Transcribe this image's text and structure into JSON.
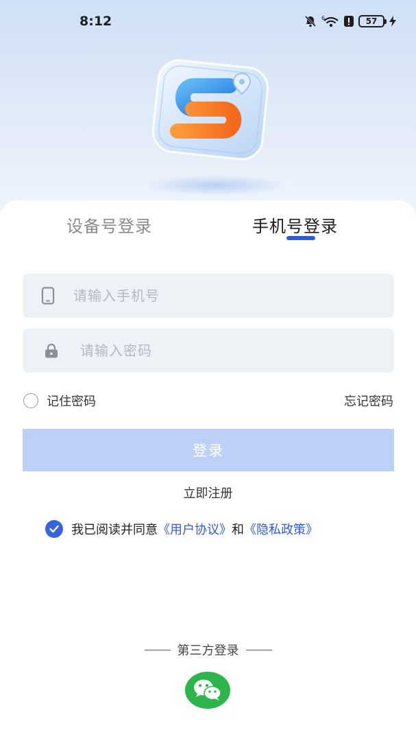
{
  "status_bar": {
    "time": "8:12",
    "battery": "57",
    "icons": [
      "mute-bell-icon",
      "wifi-icon",
      "alert-icon",
      "battery-icon",
      "charging-icon"
    ]
  },
  "tabs": {
    "device_login": "设备号登录",
    "phone_login": "手机号登录",
    "active": "phone_login"
  },
  "form": {
    "phone_placeholder": "请输入手机号",
    "phone_value": "",
    "password_placeholder": "请输入密码",
    "password_value": "",
    "remember_label": "记住密码",
    "remember_checked": false,
    "forgot_label": "忘记密码"
  },
  "actions": {
    "login_label": "登录",
    "register_label": "立即注册"
  },
  "agreement": {
    "checked": true,
    "prefix": "我已阅读并同意",
    "user_agreement": "《用户协议》",
    "conjunction": "和",
    "privacy_policy": "《隐私政策》"
  },
  "third_party": {
    "label": "第三方登录",
    "providers": [
      "wechat-icon"
    ]
  },
  "colors": {
    "accent": "#2f5ad8",
    "login_button_disabled": "#bcd0f8",
    "input_bg": "#eef1f6",
    "wechat_green": "#2bb54a"
  }
}
